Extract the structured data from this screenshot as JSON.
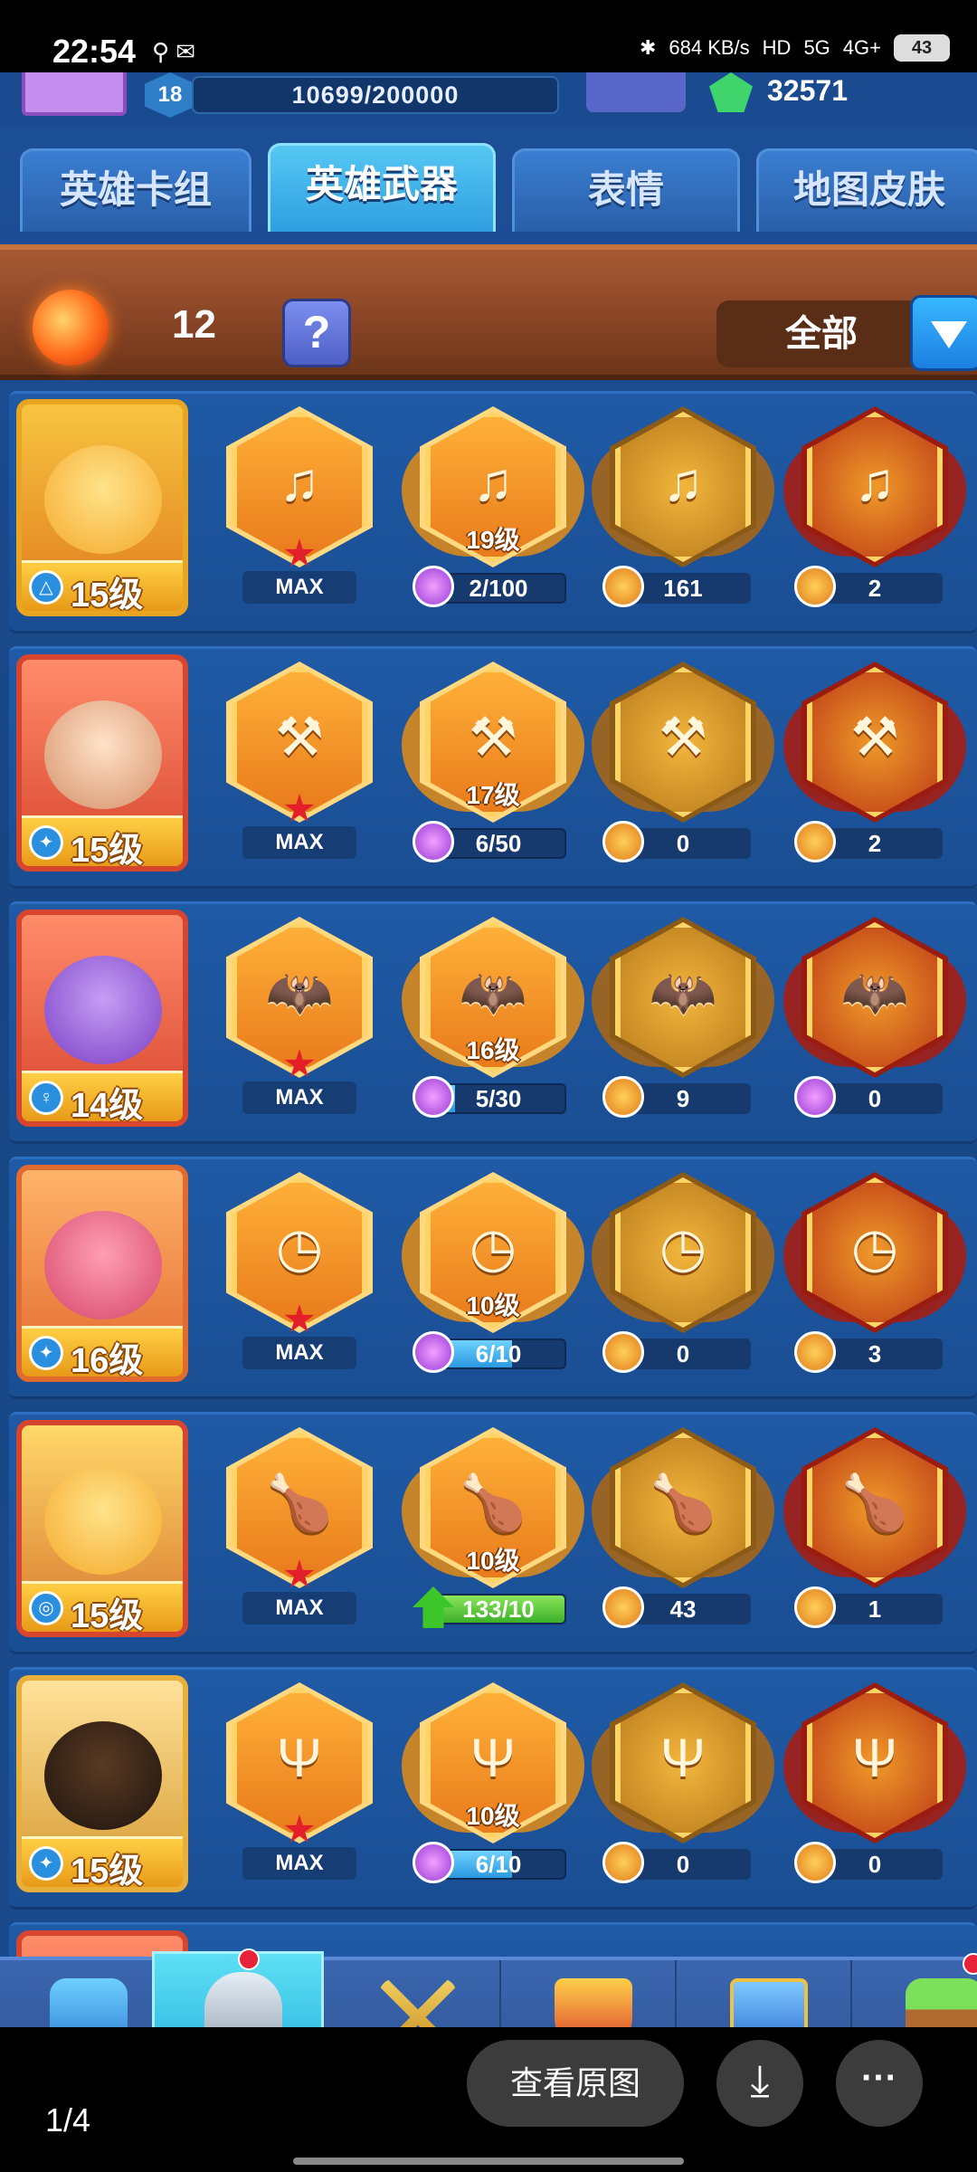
{
  "status_bar": {
    "time": "22:54",
    "network_speed": "684 KB/s",
    "signal_labels": [
      "HD",
      "5G",
      "4G+"
    ],
    "battery": "43"
  },
  "top_bar": {
    "player_level": "18",
    "xp": "10699/200000",
    "gems": "32571"
  },
  "tabs": [
    {
      "label": "英雄卡组",
      "active": false
    },
    {
      "label": "英雄武器",
      "active": true
    },
    {
      "label": "表情",
      "active": false
    },
    {
      "label": "地图皮肤",
      "active": false
    }
  ],
  "filter_bar": {
    "orb_count": "12",
    "help_label": "?",
    "filter_value": "全部"
  },
  "rows": [
    {
      "hero_level": "15级",
      "weapon_icon": "lyre-icon",
      "weapon_glyph": "♫",
      "max": "MAX",
      "upgrade_level": "19级",
      "progress": "2/100",
      "progress_ratio": 0.02,
      "gold_count": "161",
      "red_count": "2"
    },
    {
      "hero_level": "15级",
      "weapon_icon": "axe-icon",
      "weapon_glyph": "⚒",
      "max": "MAX",
      "upgrade_level": "17级",
      "progress": "6/50",
      "progress_ratio": 0.12,
      "gold_count": "0",
      "red_count": "2"
    },
    {
      "hero_level": "14级",
      "weapon_icon": "bat-icon",
      "weapon_glyph": "🦇",
      "max": "MAX",
      "upgrade_level": "16级",
      "progress": "5/30",
      "progress_ratio": 0.17,
      "gold_count": "9",
      "red_count": "0"
    },
    {
      "hero_level": "16级",
      "weapon_icon": "pocket-watch-icon",
      "weapon_glyph": "◷",
      "max": "MAX",
      "upgrade_level": "10级",
      "progress": "6/10",
      "progress_ratio": 0.6,
      "gold_count": "0",
      "red_count": "3"
    },
    {
      "hero_level": "15级",
      "weapon_icon": "drumstick-icon",
      "weapon_glyph": "🍗",
      "max": "MAX",
      "upgrade_level": "10级",
      "progress": "133/10",
      "progress_ratio": 1.0,
      "gold_count": "43",
      "red_count": "1"
    },
    {
      "hero_level": "15级",
      "weapon_icon": "trident-icon",
      "weapon_glyph": "Ψ",
      "max": "MAX",
      "upgrade_level": "10级",
      "progress": "6/10",
      "progress_ratio": 0.6,
      "gold_count": "0",
      "red_count": "0"
    }
  ],
  "bottom_nav": [
    {
      "icon": "treasure-chest-icon",
      "label": ""
    },
    {
      "icon": "knight-helmet-icon",
      "label": "英雄",
      "active": true
    },
    {
      "icon": "crossed-swords-icon",
      "label": ""
    },
    {
      "icon": "crown-shield-icon",
      "label": ""
    },
    {
      "icon": "friends-banner-icon",
      "label": ""
    },
    {
      "icon": "sprout-icon",
      "label": ""
    }
  ],
  "viewer": {
    "page_counter": "1/4",
    "view_original": "查看原图",
    "download_glyph": "⤓",
    "more_glyph": "···"
  }
}
